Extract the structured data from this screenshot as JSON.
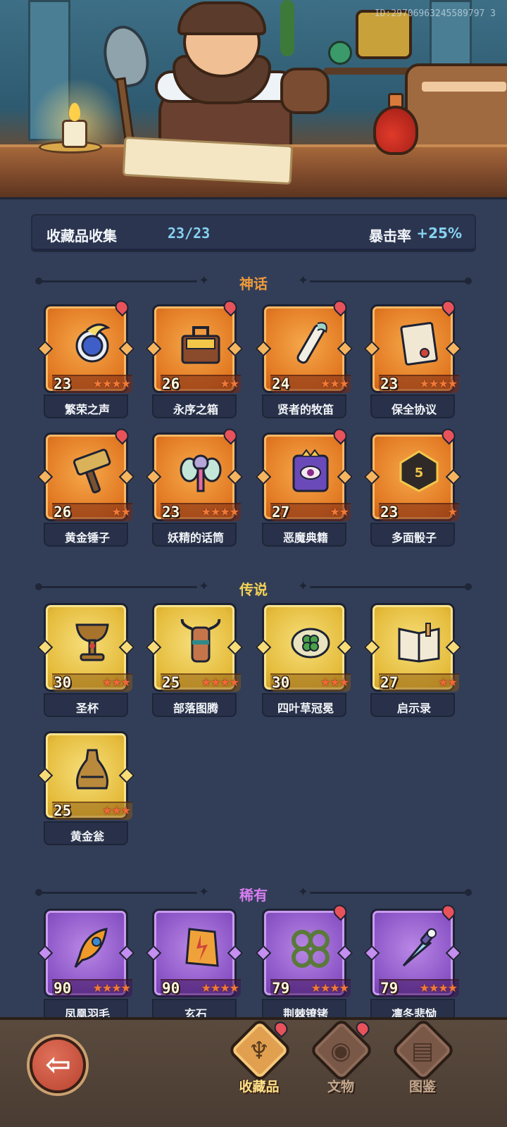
{
  "header": {
    "player_id": "ID:29706963245589797 3"
  },
  "summary": {
    "label": "收藏品收集",
    "count": "23/23",
    "crit_label": "暴击率",
    "crit_value": "+25%"
  },
  "sections": {
    "myth": {
      "title": "神话",
      "items": [
        {
          "name": "繁荣之声",
          "level": "23",
          "stars": "★★★★",
          "icon": "spirit-orb-icon",
          "alert": true
        },
        {
          "name": "永序之箱",
          "level": "26",
          "stars": "★★",
          "icon": "treasure-chest-icon",
          "alert": true
        },
        {
          "name": "贤者的牧笛",
          "level": "24",
          "stars": "★★★",
          "icon": "flute-icon",
          "alert": true
        },
        {
          "name": "保全协议",
          "level": "23",
          "stars": "★★★★",
          "icon": "scroll-contract-icon",
          "alert": true
        },
        {
          "name": "黄金锤子",
          "level": "26",
          "stars": "★★",
          "icon": "hammer-icon",
          "alert": true
        },
        {
          "name": "妖精的话筒",
          "level": "23",
          "stars": "★★★★",
          "icon": "fairy-microphone-icon",
          "alert": true
        },
        {
          "name": "恶魔典籍",
          "level": "27",
          "stars": "★★",
          "icon": "demon-tome-icon",
          "alert": true
        },
        {
          "name": "多面骰子",
          "level": "23",
          "stars": "★",
          "icon": "dice-icon",
          "alert": true
        }
      ]
    },
    "legend": {
      "title": "传说",
      "items": [
        {
          "name": "圣杯",
          "level": "30",
          "stars": "★★★",
          "icon": "chalice-icon",
          "alert": false
        },
        {
          "name": "部落图腾",
          "level": "25",
          "stars": "★★★★",
          "icon": "totem-icon",
          "alert": false
        },
        {
          "name": "四叶草冠冕",
          "level": "30",
          "stars": "★★★",
          "icon": "clover-crown-icon",
          "alert": false
        },
        {
          "name": "启示录",
          "level": "27",
          "stars": "★★",
          "icon": "open-book-icon",
          "alert": false
        },
        {
          "name": "黄金瓮",
          "level": "25",
          "stars": "★★★",
          "icon": "urn-icon",
          "alert": false
        }
      ]
    },
    "rare": {
      "title": "稀有",
      "items": [
        {
          "name": "凤凰羽毛",
          "level": "90",
          "stars": "★★★★",
          "icon": "phoenix-feather-icon",
          "alert": false
        },
        {
          "name": "玄石",
          "level": "90",
          "stars": "★★★★",
          "icon": "lightning-stone-icon",
          "alert": false
        },
        {
          "name": "荆棘镣铐",
          "level": "79",
          "stars": "★★★★",
          "icon": "thorn-shackles-icon",
          "alert": true
        },
        {
          "name": "凛冬悲恸",
          "level": "79",
          "stars": "★★★★",
          "icon": "frost-dagger-icon",
          "alert": true
        }
      ]
    }
  },
  "nav": {
    "back_glyph": "back-arrow-icon",
    "tabs": [
      {
        "label": "收藏品",
        "icon": "harp-icon",
        "active": true,
        "alert": true
      },
      {
        "label": "文物",
        "icon": "eye-icon",
        "active": false,
        "alert": true
      },
      {
        "label": "图鉴",
        "icon": "book-icon",
        "active": false,
        "alert": false
      }
    ]
  },
  "colors": {
    "myth": "#e27a24",
    "legend": "#e5bc3c",
    "rare": "#8b55c6",
    "accent_blue": "#86d2f2",
    "alert_red": "#e8525a"
  }
}
